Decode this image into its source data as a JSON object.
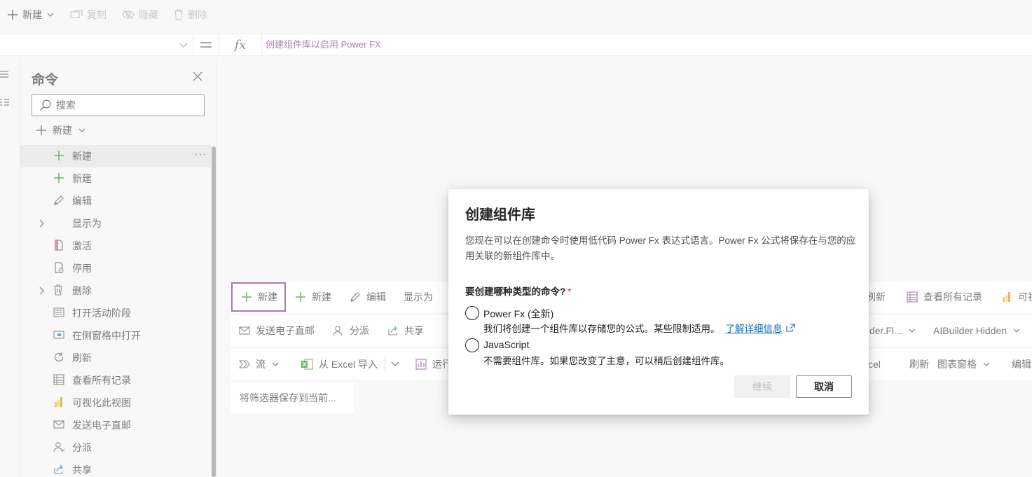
{
  "topbar": {
    "new_label": "新建",
    "copy_label": "复制",
    "hide_label": "隐藏",
    "delete_label": "删除"
  },
  "formula_bar": {
    "fx": "fx",
    "text": "创建组件库以启用 Power FX"
  },
  "pane": {
    "title": "命令",
    "search_placeholder": "搜索",
    "new_label": "新建",
    "more": "···",
    "items": [
      {
        "label": "新建",
        "icon": "plus-icon",
        "selected": true
      },
      {
        "label": "新建",
        "icon": "plus-icon"
      },
      {
        "label": "编辑",
        "icon": "pencil-icon"
      },
      {
        "label": "显示为",
        "icon": "",
        "expand": true
      },
      {
        "label": "激活",
        "icon": "document-activate-icon"
      },
      {
        "label": "停用",
        "icon": "document-deactivate-icon"
      },
      {
        "label": "删除",
        "icon": "trash-icon",
        "expand": true
      },
      {
        "label": "打开活动阶段",
        "icon": "stages-icon"
      },
      {
        "label": "在侧窗格中打开",
        "icon": "side-panel-icon"
      },
      {
        "label": "刷新",
        "icon": "refresh-icon"
      },
      {
        "label": "查看所有记录",
        "icon": "table-icon"
      },
      {
        "label": "可视化此视图",
        "icon": "powerbi-icon"
      },
      {
        "label": "发送电子直邮",
        "icon": "mail-icon"
      },
      {
        "label": "分派",
        "icon": "person-icon"
      },
      {
        "label": "共享",
        "icon": "share-icon"
      }
    ]
  },
  "canvas": {
    "row1": {
      "new_selected": "新建",
      "new": "新建",
      "edit": "编辑",
      "show_as": "显示为",
      "refresh": "刷新",
      "view_all": "查看所有记录",
      "visualize_partial": "可视"
    },
    "row2": {
      "send_mail": "发送电子直邮",
      "assign": "分派",
      "share": "共享",
      "flow_partial": "der.Fl...",
      "ai_hidden": "AIBuilder Hidden"
    },
    "row3": {
      "flow": "流",
      "import_excel": "从 Excel 导入",
      "run_partial": "运行",
      "excel_partial": "cel",
      "refresh": "刷新",
      "chart_pane": "图表窗格",
      "edit_partial": "编辑"
    },
    "save_filter": "将筛选器保存到当前..."
  },
  "dialog": {
    "title": "创建组件库",
    "description": "您现在可以在创建命令时使用低代码 Power Fx 表达式语言。Power Fx 公式将保存在与您的应用关联的新组件库中。",
    "question": "要创建哪种类型的命令?",
    "required_mark": "*",
    "options": [
      {
        "label": "Power Fx (全新)",
        "sub": "我们将创建一个组件库以存储您的公式。某些限制适用。",
        "link": "了解详细信息"
      },
      {
        "label": "JavaScript",
        "sub": "不需要组件库。如果您改变了主意，可以稍后创建组件库。"
      }
    ],
    "continue_label": "继续",
    "cancel_label": "取消"
  },
  "colors": {
    "accent": "#742774",
    "link": "#0f6cbd",
    "green": "#107c10"
  }
}
